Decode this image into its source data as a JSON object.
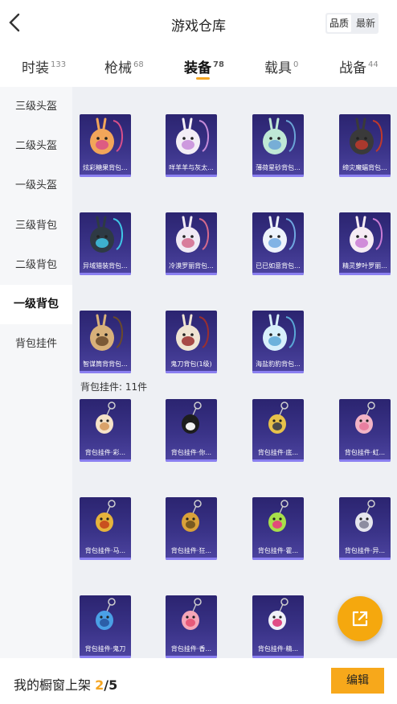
{
  "header": {
    "title": "游戏仓库",
    "sort_options": [
      "品质",
      "最新"
    ],
    "sort_selected": "品质"
  },
  "tabs": [
    {
      "label": "时装",
      "count": "133"
    },
    {
      "label": "枪械",
      "count": "68"
    },
    {
      "label": "装备",
      "count": "78",
      "active": true
    },
    {
      "label": "载具",
      "count": "0"
    },
    {
      "label": "战备",
      "count": "44"
    }
  ],
  "sidebar": [
    {
      "label": "三级头盔"
    },
    {
      "label": "二级头盔"
    },
    {
      "label": "一级头盔"
    },
    {
      "label": "三级背包"
    },
    {
      "label": "二级背包"
    },
    {
      "label": "一级背包",
      "active": true
    },
    {
      "label": "背包挂件"
    }
  ],
  "backpacks": [
    {
      "name": "炫彩糖果背包...",
      "icon": "donut-backpack"
    },
    {
      "name": "咩羊羊与灰太...",
      "icon": "sheep-backpack"
    },
    {
      "name": "薄荷星砂背包...",
      "icon": "mint-backpack"
    },
    {
      "name": "缔灾魔蝠背包...",
      "icon": "bat-backpack"
    },
    {
      "name": "异域猎装背包...",
      "icon": "tactical-backpack"
    },
    {
      "name": "冷漠罗丽背包...",
      "icon": "bunny-backpack"
    },
    {
      "name": "已已如意背包...",
      "icon": "ghost-bunny-backpack"
    },
    {
      "name": "精灵萝叶罗丽...",
      "icon": "elf-backpack"
    },
    {
      "name": "智谋筒背背包...",
      "icon": "bear-backpack"
    },
    {
      "name": "鬼刀背包(1级)",
      "icon": "ghost-blade-backpack"
    },
    {
      "name": "海盐豹豹背包...",
      "icon": "seal-backpack"
    }
  ],
  "charm_section_label": "背包挂件: 11件",
  "charms": [
    {
      "name": "背包挂件·彩...",
      "icon": "ice-cream-charm"
    },
    {
      "name": "背包挂件·你...",
      "icon": "penguin-charm"
    },
    {
      "name": "背包挂件·底...",
      "icon": "star-charm"
    },
    {
      "name": "背包挂件·虹...",
      "icon": "pig-charm"
    },
    {
      "name": "背包挂件·马...",
      "icon": "rocking-horse-charm"
    },
    {
      "name": "背包挂件·狂...",
      "icon": "blade-charm"
    },
    {
      "name": "背包挂件·霍...",
      "icon": "lightstick-charm"
    },
    {
      "name": "背包挂件·异...",
      "icon": "wings-charm"
    },
    {
      "name": "背包挂件·鬼刀",
      "icon": "feather-charm"
    },
    {
      "name": "背包挂件·香...",
      "icon": "flower-charm"
    },
    {
      "name": "背包挂件·精...",
      "icon": "heart-wings-charm"
    }
  ],
  "bottom": {
    "showcase_label": "我的橱窗上架",
    "current": "2",
    "separator": "/",
    "total": "5",
    "edit_label": "编辑"
  },
  "colors": {
    "accent": "#f5a623",
    "card_bg": "#2b2470",
    "card_edge": "#8a7ff0"
  }
}
